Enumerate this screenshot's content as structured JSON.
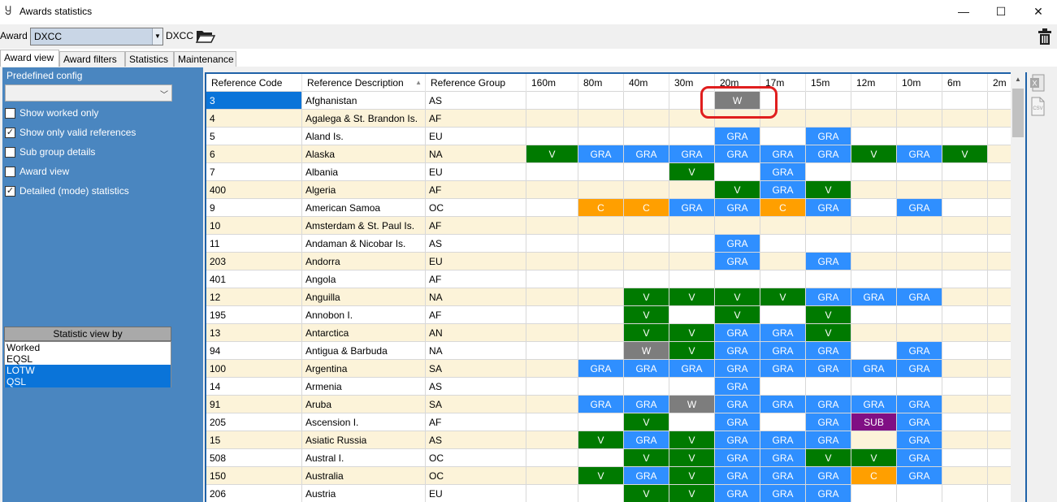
{
  "window": {
    "title": "Awards statistics",
    "minimize": "—",
    "maximize": "☐",
    "close": "✕"
  },
  "toolbar": {
    "award_label": "Award",
    "award_value": "DXCC",
    "award_name": "DXCC"
  },
  "tabs": [
    "Award view",
    "Award filters",
    "Statistics",
    "Maintenance"
  ],
  "left": {
    "predefined_label": "Predefined config",
    "predefined_value": "",
    "checks": [
      {
        "label": "Show worked only",
        "checked": false
      },
      {
        "label": "Show only valid references",
        "checked": true
      },
      {
        "label": "Sub group details",
        "checked": false
      },
      {
        "label": "Award view",
        "checked": false
      },
      {
        "label": "Detailed (mode) statistics",
        "checked": true
      }
    ],
    "stat_view_title": "Statistic view by",
    "stat_view_items": [
      {
        "label": "Worked",
        "selected": false
      },
      {
        "label": "EQSL",
        "selected": false
      },
      {
        "label": "LOTW",
        "selected": true
      },
      {
        "label": "QSL",
        "selected": true
      }
    ]
  },
  "colors": {
    "V": "#007a00",
    "GRA": "#2f8fff",
    "C": "#ff9f00",
    "W": "#7d7d7d",
    "SUB": "#800f84",
    "row_alt": "#fcf3d9",
    "selection": "#0a74d9"
  },
  "grid": {
    "headers": [
      "Reference Code",
      "Reference Description",
      "Reference Group",
      "160m",
      "80m",
      "40m",
      "30m",
      "20m",
      "17m",
      "15m",
      "12m",
      "10m",
      "6m",
      "2m"
    ],
    "rows": [
      [
        "3",
        "Afghanistan",
        "AS",
        "",
        "",
        "",
        "",
        "W",
        "",
        "",
        "",
        "",
        "",
        ""
      ],
      [
        "4",
        "Agalega & St. Brandon Is.",
        "AF",
        "",
        "",
        "",
        "",
        "",
        "",
        "",
        "",
        "",
        "",
        ""
      ],
      [
        "5",
        "Aland Is.",
        "EU",
        "",
        "",
        "",
        "",
        "GRA",
        "",
        "GRA",
        "",
        "",
        "",
        ""
      ],
      [
        "6",
        "Alaska",
        "NA",
        "V",
        "GRA",
        "GRA",
        "GRA",
        "GRA",
        "GRA",
        "GRA",
        "V",
        "GRA",
        "V",
        ""
      ],
      [
        "7",
        "Albania",
        "EU",
        "",
        "",
        "",
        "V",
        "",
        "GRA",
        "",
        "",
        "",
        "",
        ""
      ],
      [
        "400",
        "Algeria",
        "AF",
        "",
        "",
        "",
        "",
        "V",
        "GRA",
        "V",
        "",
        "",
        "",
        ""
      ],
      [
        "9",
        "American Samoa",
        "OC",
        "",
        "C",
        "C",
        "GRA",
        "GRA",
        "C",
        "GRA",
        "",
        "GRA",
        "",
        ""
      ],
      [
        "10",
        "Amsterdam & St. Paul Is.",
        "AF",
        "",
        "",
        "",
        "",
        "",
        "",
        "",
        "",
        "",
        "",
        ""
      ],
      [
        "11",
        "Andaman & Nicobar Is.",
        "AS",
        "",
        "",
        "",
        "",
        "GRA",
        "",
        "",
        "",
        "",
        "",
        ""
      ],
      [
        "203",
        "Andorra",
        "EU",
        "",
        "",
        "",
        "",
        "GRA",
        "",
        "GRA",
        "",
        "",
        "",
        ""
      ],
      [
        "401",
        "Angola",
        "AF",
        "",
        "",
        "",
        "",
        "",
        "",
        "",
        "",
        "",
        "",
        ""
      ],
      [
        "12",
        "Anguilla",
        "NA",
        "",
        "",
        "V",
        "V",
        "V",
        "V",
        "GRA",
        "GRA",
        "GRA",
        "",
        ""
      ],
      [
        "195",
        "Annobon I.",
        "AF",
        "",
        "",
        "V",
        "",
        "V",
        "",
        "V",
        "",
        "",
        "",
        ""
      ],
      [
        "13",
        "Antarctica",
        "AN",
        "",
        "",
        "V",
        "V",
        "GRA",
        "GRA",
        "V",
        "",
        "",
        "",
        ""
      ],
      [
        "94",
        "Antigua & Barbuda",
        "NA",
        "",
        "",
        "W",
        "V",
        "GRA",
        "GRA",
        "GRA",
        "",
        "GRA",
        "",
        ""
      ],
      [
        "100",
        "Argentina",
        "SA",
        "",
        "GRA",
        "GRA",
        "GRA",
        "GRA",
        "GRA",
        "GRA",
        "GRA",
        "GRA",
        "",
        ""
      ],
      [
        "14",
        "Armenia",
        "AS",
        "",
        "",
        "",
        "",
        "GRA",
        "",
        "",
        "",
        "",
        "",
        ""
      ],
      [
        "91",
        "Aruba",
        "SA",
        "",
        "GRA",
        "GRA",
        "W",
        "GRA",
        "GRA",
        "GRA",
        "GRA",
        "GRA",
        "",
        ""
      ],
      [
        "205",
        "Ascension I.",
        "AF",
        "",
        "",
        "V",
        "",
        "GRA",
        "",
        "GRA",
        "SUB",
        "GRA",
        "",
        ""
      ],
      [
        "15",
        "Asiatic Russia",
        "AS",
        "",
        "V",
        "GRA",
        "V",
        "GRA",
        "GRA",
        "GRA",
        "",
        "GRA",
        "",
        ""
      ],
      [
        "508",
        "Austral I.",
        "OC",
        "",
        "",
        "V",
        "V",
        "GRA",
        "GRA",
        "V",
        "V",
        "GRA",
        "",
        ""
      ],
      [
        "150",
        "Australia",
        "OC",
        "",
        "V",
        "GRA",
        "V",
        "GRA",
        "GRA",
        "GRA",
        "C",
        "GRA",
        "",
        ""
      ],
      [
        "206",
        "Austria",
        "EU",
        "",
        "",
        "V",
        "V",
        "GRA",
        "GRA",
        "GRA",
        "",
        "",
        "",
        ""
      ]
    ]
  }
}
